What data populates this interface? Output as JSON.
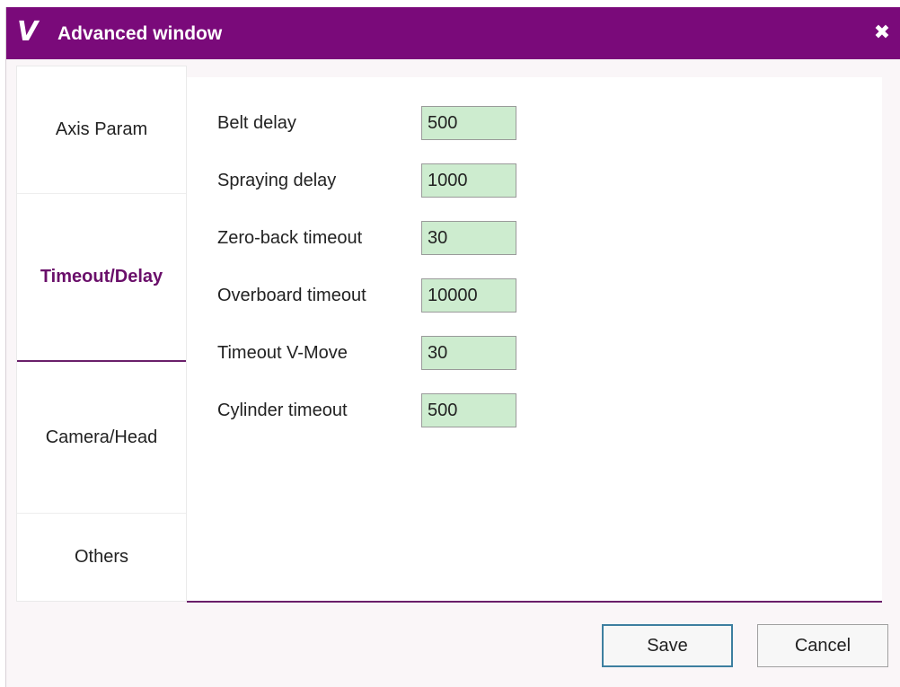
{
  "window": {
    "logo_text": "V",
    "title": "Advanced window",
    "close_symbol": "✖",
    "accent_color": "#7a0a7a"
  },
  "sidebar": {
    "tabs": [
      {
        "label": "Axis Param",
        "active": false
      },
      {
        "label": "Timeout/Delay",
        "active": true
      },
      {
        "label": "Camera/Head",
        "active": false
      },
      {
        "label": "Others",
        "active": false
      }
    ]
  },
  "fields": [
    {
      "label": "Belt delay",
      "value": "500"
    },
    {
      "label": "Spraying delay",
      "value": "1000"
    },
    {
      "label": "Zero-back timeout",
      "value": "30"
    },
    {
      "label": "Overboard timeout",
      "value": "10000"
    },
    {
      "label": "Timeout V-Move",
      "value": "30"
    },
    {
      "label": "Cylinder timeout",
      "value": "500"
    }
  ],
  "buttons": {
    "save": "Save",
    "cancel": "Cancel"
  },
  "icons": {
    "logo": "v-logo-icon",
    "close": "close-icon"
  }
}
